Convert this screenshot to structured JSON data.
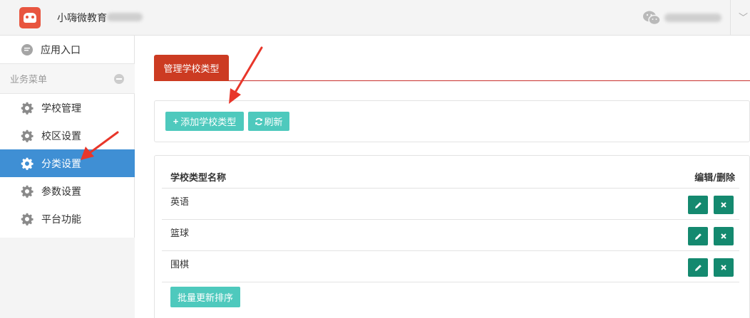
{
  "header": {
    "app_name": "小嗨微教育",
    "user_name_redacted": "",
    "dropdown_icon": "chevron-down-icon"
  },
  "sidebar": {
    "app_entry": "应用入口",
    "section_title": "业务菜单",
    "items": [
      {
        "label": "学校管理",
        "icon": "gear-icon"
      },
      {
        "label": "校区设置",
        "icon": "gear-icon"
      },
      {
        "label": "分类设置",
        "icon": "gear-icon",
        "active": true
      },
      {
        "label": "参数设置",
        "icon": "gear-icon"
      },
      {
        "label": "平台功能",
        "icon": "gear-icon"
      }
    ]
  },
  "main": {
    "tab_label": "管理学校类型",
    "add_button": "添加学校类型",
    "add_icon": "+",
    "refresh_button": "刷新",
    "table": {
      "col_name": "学校类型名称",
      "col_actions": "编辑/删除",
      "rows": [
        {
          "name": "英语"
        },
        {
          "name": "篮球"
        },
        {
          "name": "围棋"
        }
      ]
    },
    "batch_button": "批量更新排序"
  },
  "colors": {
    "accent_red": "#cc3b22",
    "active_blue": "#3f8fd4",
    "teal": "#4ec9bd",
    "dark_teal": "#14896f",
    "annotation_arrow": "#e8362a"
  }
}
